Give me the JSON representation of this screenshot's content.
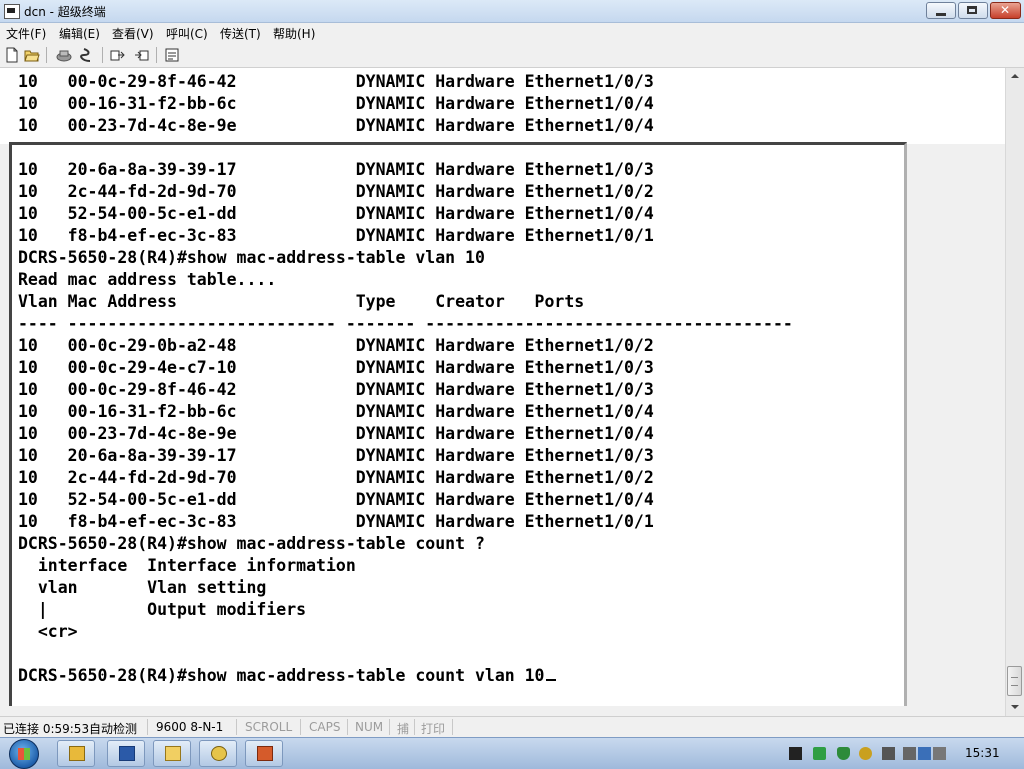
{
  "window": {
    "title": "dcn - 超级终端"
  },
  "menu": {
    "items": [
      "文件(F)",
      "编辑(E)",
      "查看(V)",
      "呼叫(C)",
      "传送(T)",
      "帮助(H)"
    ]
  },
  "toolbar": {
    "icons": [
      "new-connection-icon",
      "open-icon",
      "disconnect-icon",
      "call-icon",
      "send-icon",
      "receive-icon",
      "properties-icon"
    ]
  },
  "terminal": {
    "lines": [
      "10   00-0c-29-8f-46-42            DYNAMIC Hardware Ethernet1/0/3",
      "10   00-16-31-f2-bb-6c            DYNAMIC Hardware Ethernet1/0/4",
      "10   00-23-7d-4c-8e-9e            DYNAMIC Hardware Ethernet1/0/4",
      "10   20-6a-8a-39-39-17            DYNAMIC Hardware Ethernet1/0/3",
      "10   2c-44-fd-2d-9d-70            DYNAMIC Hardware Ethernet1/0/2",
      "10   52-54-00-5c-e1-dd            DYNAMIC Hardware Ethernet1/0/4",
      "10   f8-b4-ef-ec-3c-83            DYNAMIC Hardware Ethernet1/0/1",
      "DCRS-5650-28(R4)#show mac-address-table vlan 10",
      "Read mac address table....",
      "Vlan Mac Address                  Type    Creator   Ports",
      "---- --------------------------- ------- -------------------------------------",
      "10   00-0c-29-0b-a2-48            DYNAMIC Hardware Ethernet1/0/2",
      "10   00-0c-29-4e-c7-10            DYNAMIC Hardware Ethernet1/0/3",
      "10   00-0c-29-8f-46-42            DYNAMIC Hardware Ethernet1/0/3",
      "10   00-16-31-f2-bb-6c            DYNAMIC Hardware Ethernet1/0/4",
      "10   00-23-7d-4c-8e-9e            DYNAMIC Hardware Ethernet1/0/4",
      "10   20-6a-8a-39-39-17            DYNAMIC Hardware Ethernet1/0/3",
      "10   2c-44-fd-2d-9d-70            DYNAMIC Hardware Ethernet1/0/2",
      "10   52-54-00-5c-e1-dd            DYNAMIC Hardware Ethernet1/0/4",
      "10   f8-b4-ef-ec-3c-83            DYNAMIC Hardware Ethernet1/0/1",
      "DCRS-5650-28(R4)#show mac-address-table count ?",
      "  interface  Interface information",
      "  vlan       Vlan setting",
      "  |          Output modifiers",
      "  <cr>",
      "",
      "DCRS-5650-28(R4)#show mac-address-table count vlan 10"
    ]
  },
  "statusbar": {
    "connected": "已连接 0:59:53",
    "detect": "自动检测",
    "settings": "9600 8-N-1",
    "scroll": "SCROLL",
    "caps": "CAPS",
    "num": "NUM",
    "capture": "捕",
    "print": "打印"
  },
  "taskbar": {
    "clock": "15:31",
    "apps": [
      "explorer-icon",
      "word-icon",
      "folder-icon",
      "hyperterminal-icon",
      "powerpoint-icon"
    ]
  }
}
